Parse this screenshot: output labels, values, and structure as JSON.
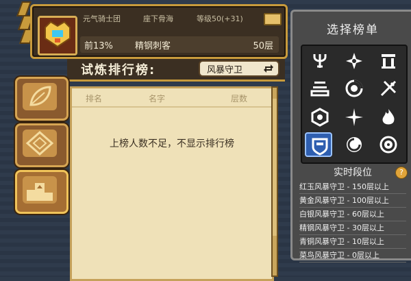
{
  "player": {
    "guild": "元气骑士团",
    "subtitle": "座下骨海",
    "level": "等级50(+31)",
    "percent": "前13%",
    "rank_name": "精钢刺客",
    "floor": "50层"
  },
  "trial": {
    "title": "试炼排行榜:",
    "boss": "风暴守卫"
  },
  "board": {
    "columns": [
      "排名",
      "名字",
      "层数"
    ],
    "empty_message": "上榜人数不足，不显示排行榜"
  },
  "panel": {
    "title": "选择榜单",
    "rank_title": "实时段位",
    "ranks": [
      "红玉风暴守卫 - 150层以上",
      "黄金风暴守卫 - 100层以上",
      "白银风暴守卫 - 60层以上",
      "精钢风暴守卫 - 30层以上",
      "青铜风暴守卫 - 10层以上",
      "菜鸟风暴守卫 - 0层以上"
    ],
    "icons": [
      "trident-icon",
      "star-icon",
      "temple-icon",
      "altar-icon",
      "vortex-icon",
      "crossed-swords-icon",
      "hexagon-icon",
      "spark-icon",
      "flame-icon",
      "shield-icon",
      "swirl-icon",
      "burst-icon"
    ]
  },
  "colors": {
    "gold": "#c89b3c",
    "parchment": "#efe1b8",
    "selected": "#2f5fb0"
  }
}
